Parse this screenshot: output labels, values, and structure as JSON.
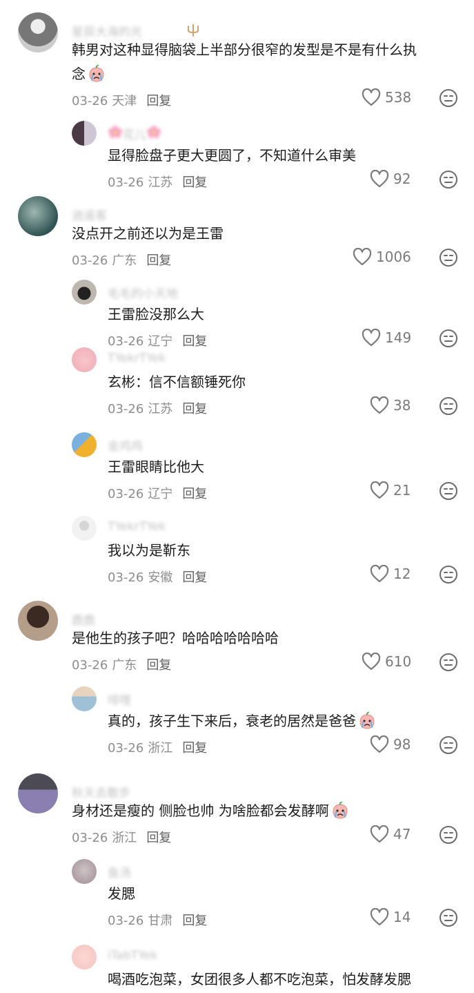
{
  "comments": [
    {
      "level": "top",
      "user": "星辰大海的光",
      "text_lines": [
        "韩男对这种显得脑袋上半部分很窄的发型是不是有什么执",
        "念"
      ],
      "emoji_after": true,
      "date": "03-26",
      "location": "天津",
      "reply": "回复",
      "likes": "538"
    },
    {
      "level": "sub",
      "user": "花儿",
      "text_lines": [
        "显得脸盘子更大更圆了，不知道什么审美"
      ],
      "emoji_after": false,
      "date": "03-26",
      "location": "江苏",
      "reply": "回复",
      "likes": "92"
    },
    {
      "level": "top",
      "user": "逍遥客",
      "text_lines": [
        "没点开之前还以为是王雷"
      ],
      "emoji_after": false,
      "date": "03-26",
      "location": "广东",
      "reply": "回复",
      "likes": "1006"
    },
    {
      "level": "sub",
      "user": "毛毛的小天地",
      "text_lines": [
        "王雷脸没那么大"
      ],
      "emoji_after": false,
      "date": "03-26",
      "location": "辽宁",
      "reply": "回复",
      "likes": "149"
    },
    {
      "level": "sub",
      "user": "TYekrTYek",
      "text_lines": [
        "玄彬：信不信额锤死你"
      ],
      "emoji_after": false,
      "date": "03-26",
      "location": "江苏",
      "reply": "回复",
      "likes": "38"
    },
    {
      "level": "sub",
      "user": "金鸡鸡",
      "text_lines": [
        "王雷眼睛比他大"
      ],
      "emoji_after": false,
      "date": "03-26",
      "location": "辽宁",
      "reply": "回复",
      "likes": "21"
    },
    {
      "level": "sub",
      "user": "TYekrTYek",
      "text_lines": [
        "我以为是靳东"
      ],
      "emoji_after": false,
      "date": "03-26",
      "location": "安徽",
      "reply": "回复",
      "likes": "12"
    },
    {
      "level": "top",
      "user": "鹿鹿",
      "text_lines": [
        "是他生的孩子吧？哈哈哈哈哈哈哈"
      ],
      "emoji_after": false,
      "date": "03-26",
      "location": "广东",
      "reply": "回复",
      "likes": "610"
    },
    {
      "level": "sub",
      "user": "啡哩",
      "text_lines": [
        "真的，孩子生下来后，衰老的居然是爸爸"
      ],
      "emoji_after": true,
      "date": "03-26",
      "location": "浙江",
      "reply": "回复",
      "likes": "98"
    },
    {
      "level": "top",
      "user": "秋天去散步",
      "text_lines": [
        "身材还是瘦的 侧脸也帅 为啥脸都会发酵啊"
      ],
      "emoji_after": true,
      "date": "03-26",
      "location": "浙江",
      "reply": "回复",
      "likes": "47"
    },
    {
      "level": "sub",
      "user": "鱼汤",
      "text_lines": [
        "发腮"
      ],
      "emoji_after": false,
      "date": "03-26",
      "location": "甘肃",
      "reply": "回复",
      "likes": "14"
    },
    {
      "level": "sub",
      "user": "iTabTYek",
      "text_lines": [
        "喝酒吃泡菜，女团很多人都不吃泡菜，怕发酵发腮"
      ],
      "emoji_after": false,
      "date": "",
      "location": "",
      "reply": "",
      "likes": ""
    }
  ],
  "colors": {
    "text": "#1c1c1c",
    "meta": "#8d8d8d",
    "reply": "#5f5f5f",
    "like": "#7a7a7a",
    "username": "#c3c3c3"
  },
  "icons": {
    "like": "heart-outline-icon",
    "dislike": "neutral-face-icon",
    "emoji": "crying-peach-emoji",
    "badge": "trident-badge-icon"
  }
}
